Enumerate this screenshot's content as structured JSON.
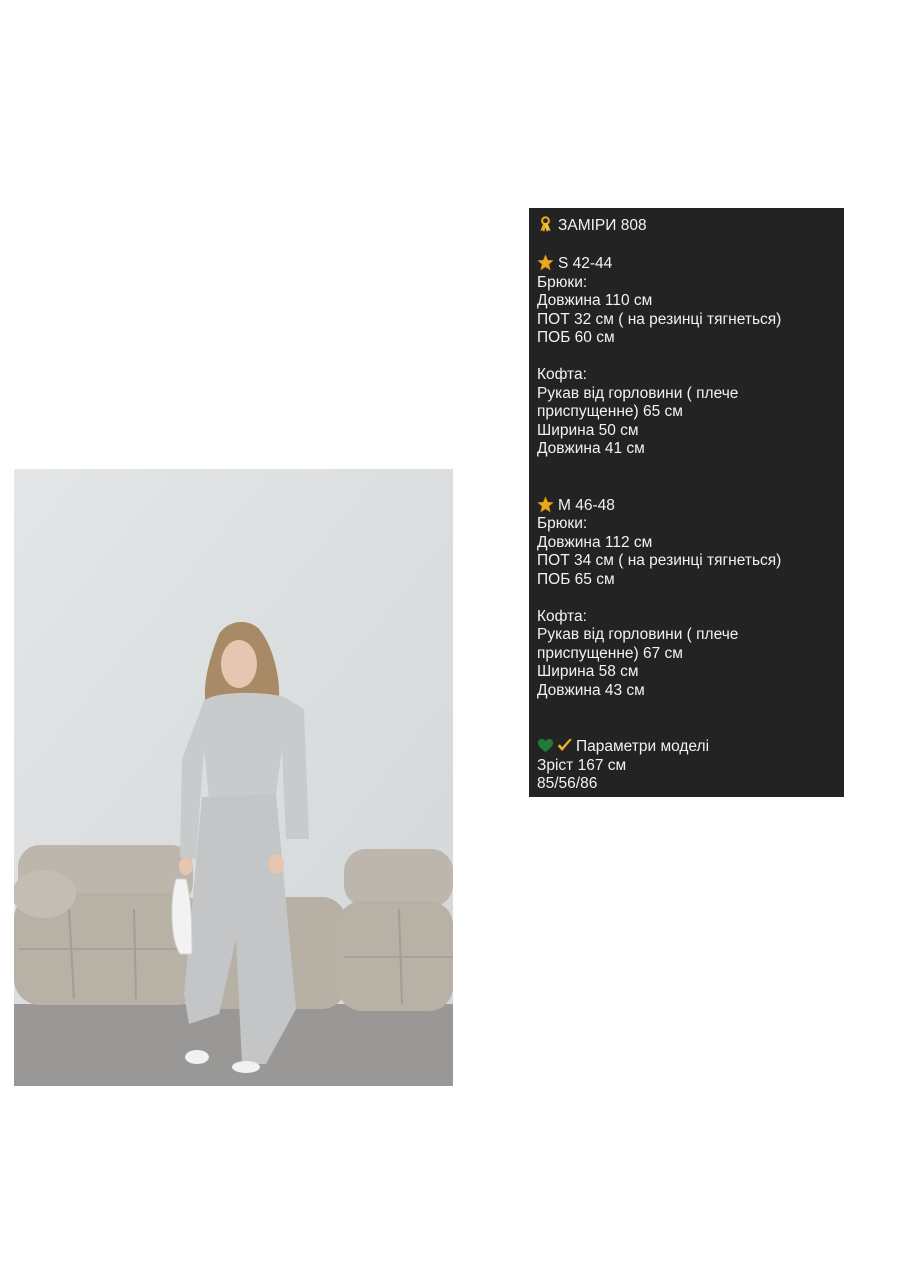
{
  "photo": {
    "subject": "model-in-grey-tracksuit",
    "colors": {
      "wall": "#dfe2e3",
      "floor": "#9a9a98",
      "sofa": "#b9b2a8",
      "outfit": "#c9cbcd"
    }
  },
  "panel": {
    "title": "ЗАМІРИ 808",
    "title_icon": "ribbon-icon",
    "size_icon": "star-icon",
    "s": {
      "header": "S 42-44",
      "pants_label": "Брюки:",
      "pants": [
        "Довжина 110 см",
        "ПОТ 32 см ( на резинці тягнеться)",
        "ПОБ 60 см"
      ],
      "top_label": "Кофта:",
      "top": [
        "Рукав  від горловини ( плече",
        "приспущенне) 65 см",
        "Ширина 50 см",
        "Довжина 41 см"
      ]
    },
    "m": {
      "header": "M 46-48",
      "pants_label": "Брюки:",
      "pants": [
        "Довжина 112 см",
        "ПОТ 34 см ( на резинці тягнеться)",
        "ПОБ 65 см"
      ],
      "top_label": "Кофта:",
      "top": [
        "Рукав від горловини ( плече",
        "приспущенне) 67 см",
        "Ширина 58 см",
        "Довжина 43 см"
      ]
    },
    "model": {
      "header": "Параметри моделі",
      "icons": [
        "green-heart-icon",
        "check-mark-icon"
      ],
      "lines": [
        "Зріст 167 см",
        "85/56/86"
      ]
    },
    "colors": {
      "background": "#232323",
      "text": "#f2f2f2",
      "emoji_gold": "#e8a91c"
    }
  }
}
